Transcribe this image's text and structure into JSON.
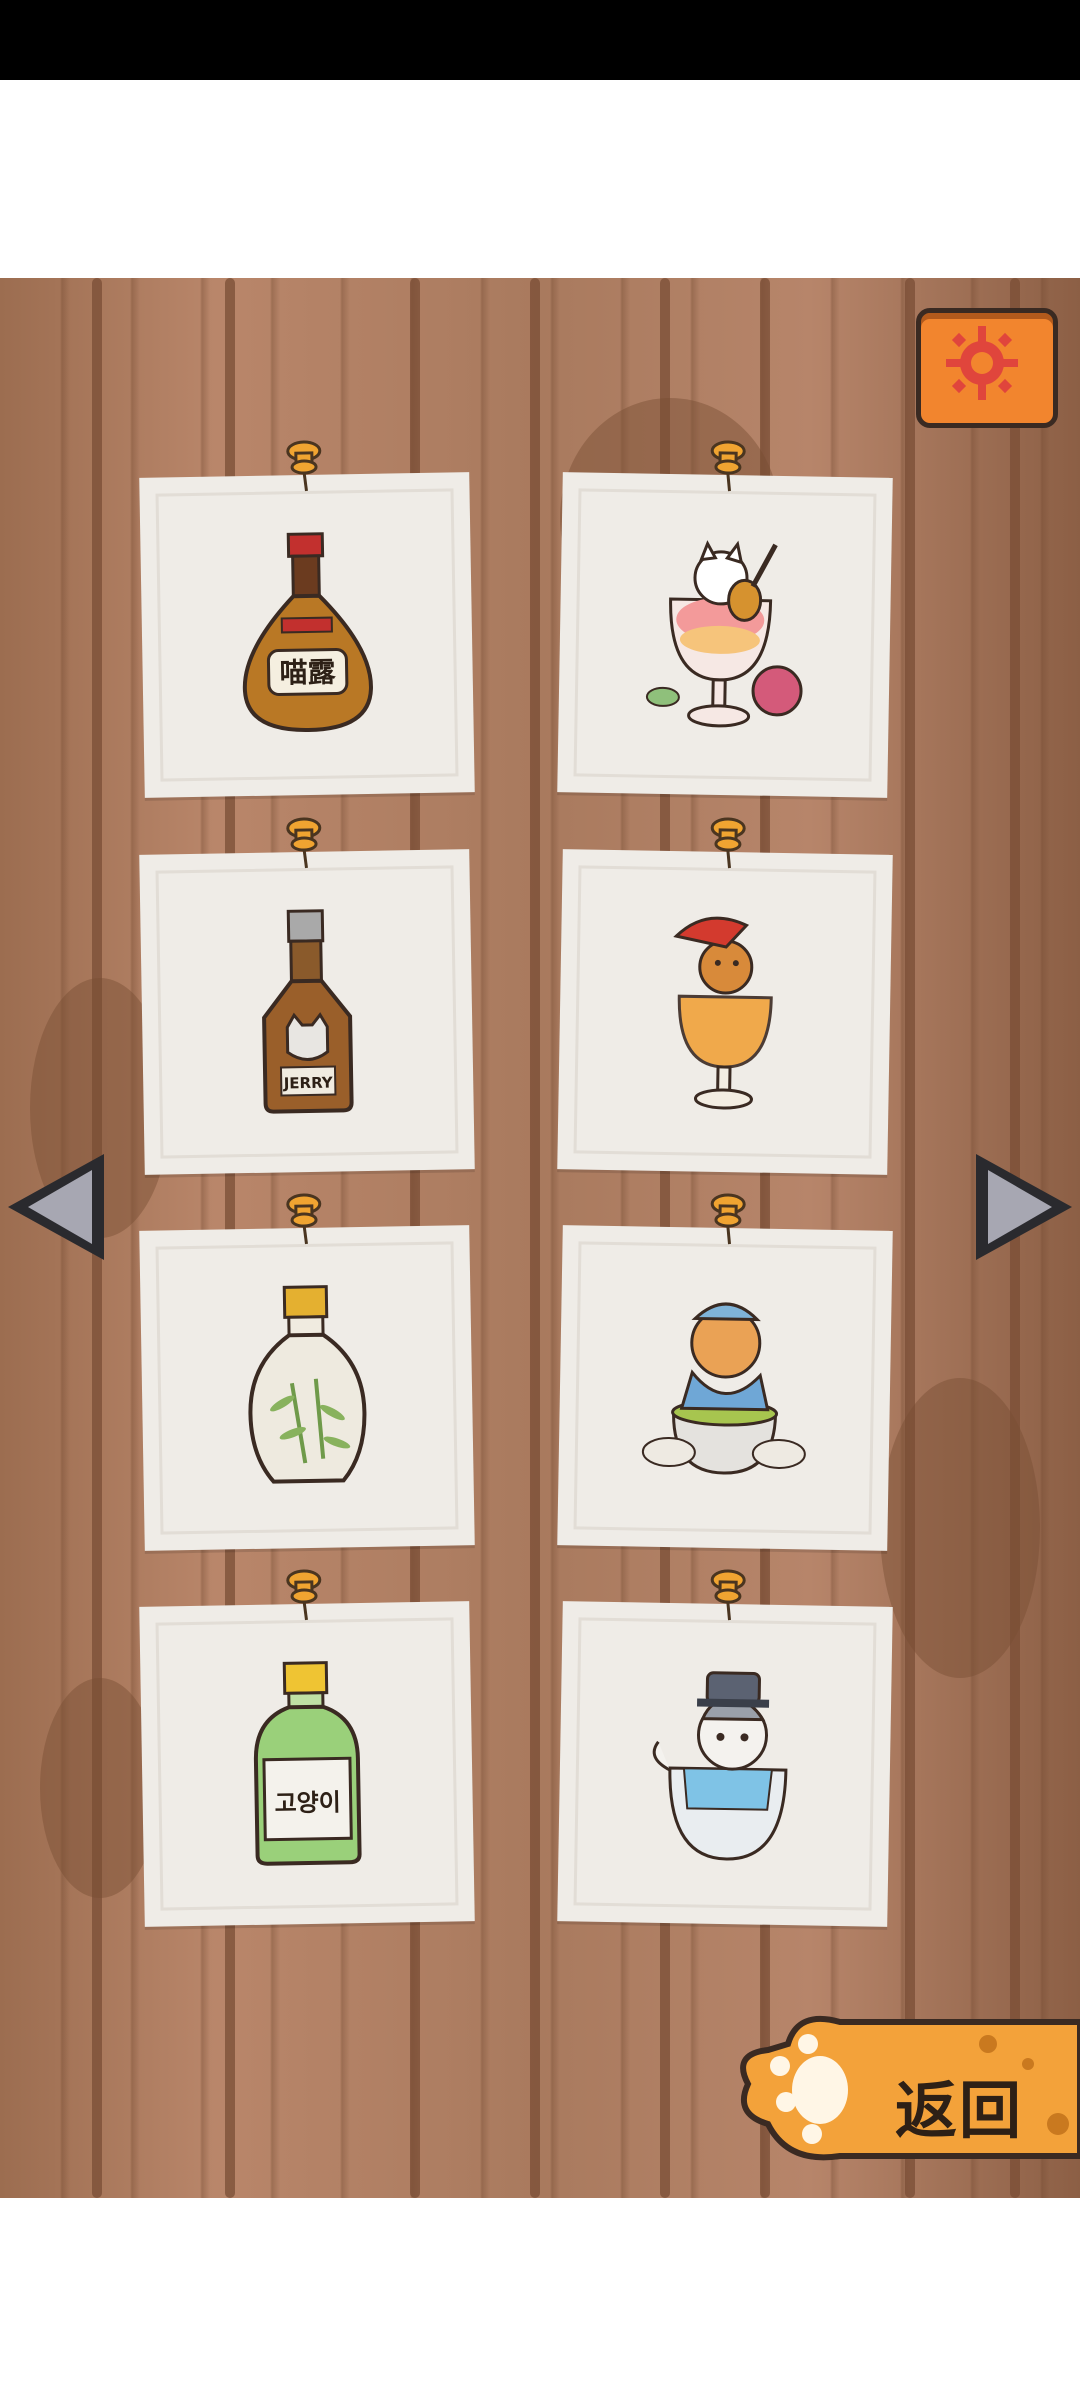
{
  "status_bar": {},
  "settings_button": {
    "icon": "gear-icon",
    "color": "#f2852e"
  },
  "navigation": {
    "prev_icon": "triangle-left-icon",
    "next_icon": "triangle-right-icon"
  },
  "cards": [
    {
      "item": "bottle-miaolu",
      "label": "喵露"
    },
    {
      "item": "cat-guitar-sundae",
      "label": ""
    },
    {
      "item": "bottle-jerry",
      "label": "JERRY"
    },
    {
      "item": "cat-pirate-drink",
      "label": ""
    },
    {
      "item": "bottle-bamboo",
      "label": ""
    },
    {
      "item": "cat-tea-cup",
      "label": ""
    },
    {
      "item": "bottle-goyangi",
      "label": "고양이"
    },
    {
      "item": "cat-hat-bowl",
      "label": ""
    }
  ],
  "back_button": {
    "label": "返回",
    "icon": "paw-icon",
    "color": "#f3a23a"
  }
}
